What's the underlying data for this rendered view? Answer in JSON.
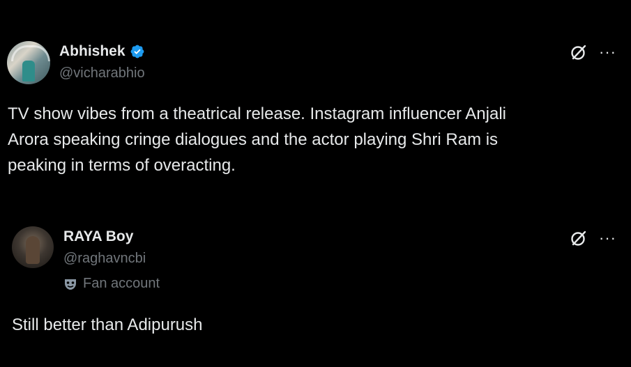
{
  "tweets": [
    {
      "name": "Abhishek",
      "handle": "@vicharabhio",
      "verified": true,
      "text_lines": [
        "TV show vibes from a theatrical release. Instagram influencer Anjali",
        "Arora speaking cringe dialogues and the actor playing Shri Ram is",
        "peaking in terms of overacting."
      ],
      "more_label": "···"
    },
    {
      "name": "RAYA Boy",
      "handle": "@raghavncbi",
      "label": "Fan account",
      "text": "Still better than Adipurush",
      "more_label": "···"
    }
  ],
  "colors": {
    "background": "#000000",
    "text": "#e7e9ea",
    "secondary": "#71767b",
    "verified": "#1d9bf0"
  },
  "icons": [
    "verified-badge-icon",
    "grok-icon",
    "more-icon",
    "fan-mask-icon"
  ]
}
